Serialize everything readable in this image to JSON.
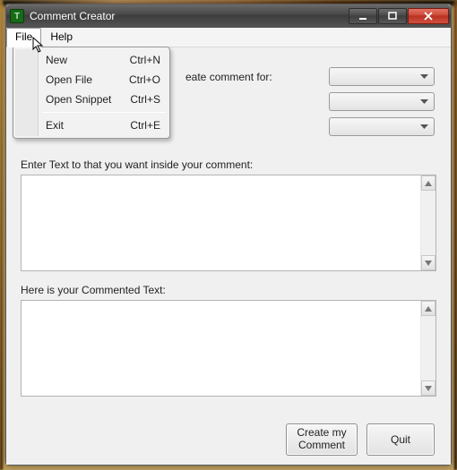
{
  "window": {
    "title": "Comment Creator",
    "icon_char": "T"
  },
  "menubar": {
    "file": "File",
    "help": "Help"
  },
  "file_menu": {
    "new": {
      "label": "New",
      "shortcut": "Ctrl+N"
    },
    "open_file": {
      "label": "Open File",
      "shortcut": "Ctrl+O"
    },
    "open_snippet": {
      "label": "Open Snippet",
      "shortcut": "Ctrl+S"
    },
    "exit": {
      "label": "Exit",
      "shortcut": "Ctrl+E"
    }
  },
  "labels": {
    "language_prompt": "eate comment for:",
    "enter_text": "Enter Text to that you want inside your comment:",
    "result_text": "Here is your Commented Text:"
  },
  "combos": {
    "c1_value": "",
    "c2_value": "",
    "c3_value": ""
  },
  "textareas": {
    "input_value": "",
    "output_value": ""
  },
  "buttons": {
    "create": "Create my Comment",
    "quit": "Quit"
  }
}
